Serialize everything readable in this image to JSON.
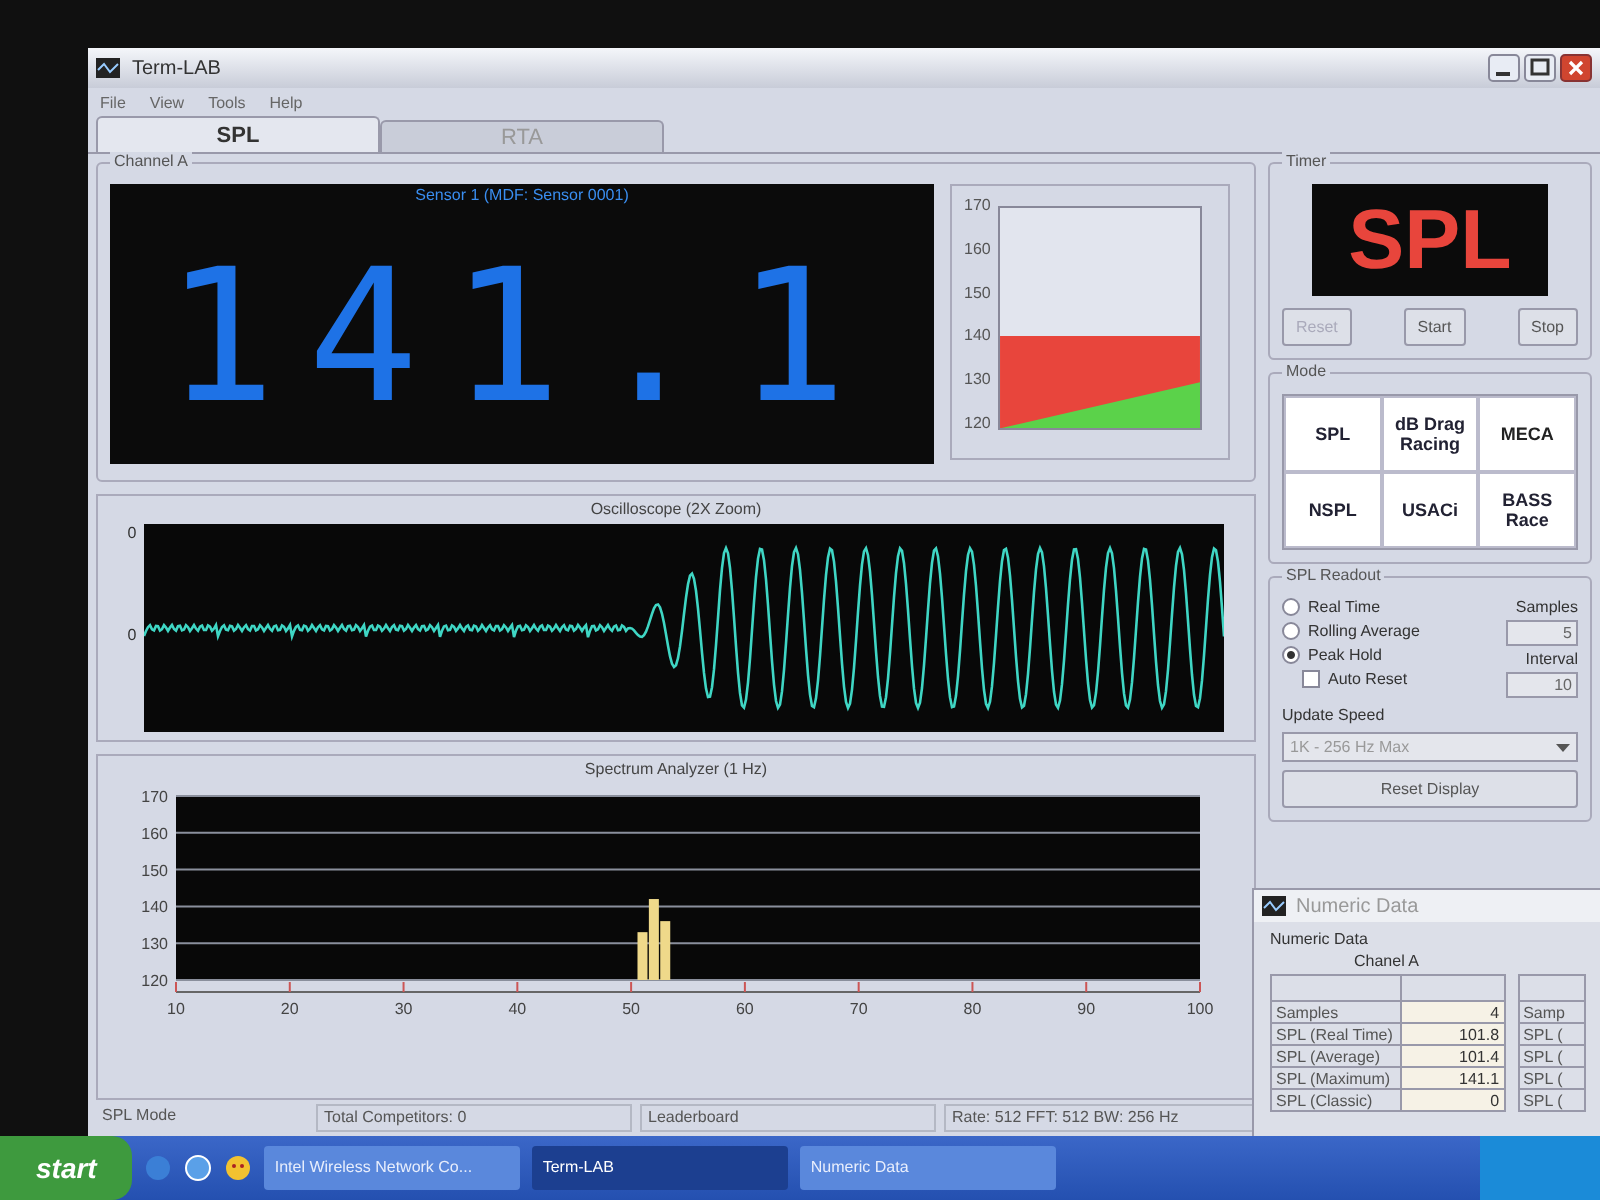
{
  "window": {
    "title": "Term-LAB",
    "menu": [
      "File",
      "View",
      "Tools",
      "Help"
    ]
  },
  "tabs": [
    {
      "label": "SPL",
      "selected": true
    },
    {
      "label": "RTA",
      "selected": false
    }
  ],
  "channel": {
    "title": "Channel A",
    "sensor": "Sensor 1 (MDF: Sensor 0001)",
    "reading": "141.1",
    "meter": {
      "ticks": [
        "170",
        "160",
        "150",
        "140",
        "130",
        "120"
      ],
      "level": 0.42
    }
  },
  "oscilloscope": {
    "title": "Oscilloscope (2X Zoom)",
    "axis_labels": [
      "0",
      "0"
    ]
  },
  "spectrum": {
    "chart_data": {
      "type": "bar",
      "title": "Spectrum Analyzer (1 Hz)",
      "x": [
        51,
        52,
        53
      ],
      "values": [
        133,
        142,
        136
      ],
      "xlim": [
        10,
        100
      ],
      "ylim": [
        120,
        170
      ],
      "xticks": [
        10,
        20,
        30,
        40,
        50,
        60,
        70,
        80,
        90,
        100
      ],
      "yticks": [
        120,
        130,
        140,
        150,
        160,
        170
      ],
      "grid": true
    }
  },
  "timer": {
    "title": "Timer",
    "display": "SPL",
    "buttons": [
      {
        "label": "Reset",
        "disabled": true
      },
      {
        "label": "Start",
        "disabled": false
      },
      {
        "label": "Stop",
        "disabled": false
      }
    ]
  },
  "mode": {
    "title": "Mode",
    "logos": [
      "SPL",
      "dB Drag Racing",
      "MECA",
      "NSPL",
      "USACi",
      "BASS Race"
    ]
  },
  "readout": {
    "title": "SPL Readout",
    "options": [
      {
        "label": "Real Time",
        "selected": false
      },
      {
        "label": "Rolling Average",
        "selected": false
      },
      {
        "label": "Peak Hold",
        "selected": true
      }
    ],
    "auto_reset": {
      "label": "Auto Reset",
      "checked": false
    },
    "samples": {
      "label": "Samples",
      "value": "5",
      "disabled": true
    },
    "interval": {
      "label": "Interval",
      "value": "10",
      "disabled": true
    },
    "update_speed": {
      "label": "Update Speed",
      "value": "1K - 256 Hz Max"
    },
    "reset_button": "Reset Display"
  },
  "numeric_window": {
    "title": "Numeric Data",
    "group": "Numeric Data",
    "channel": "Chanel A",
    "rows": [
      {
        "name": "Samples",
        "value": "4"
      },
      {
        "name": "SPL (Real Time)",
        "value": "101.8"
      },
      {
        "name": "SPL (Average)",
        "value": "101.4"
      },
      {
        "name": "SPL (Maximum)",
        "value": "141.1"
      },
      {
        "name": "SPL (Classic)",
        "value": "0"
      }
    ],
    "second_table": [
      "Samp",
      "SPL (",
      "SPL (",
      "SPL (",
      "SPL ("
    ]
  },
  "status_bar": [
    "SPL Mode",
    "Total Competitors: 0",
    "Leaderboard",
    "Rate: 512 FFT: 512 BW: 256 Hz"
  ],
  "taskbar": {
    "start": "start",
    "tasks": [
      {
        "label": "Intel Wireless Network Co...",
        "selected": false
      },
      {
        "label": "Term-LAB",
        "selected": true
      },
      {
        "label": "Numeric Data",
        "selected": false
      }
    ]
  }
}
